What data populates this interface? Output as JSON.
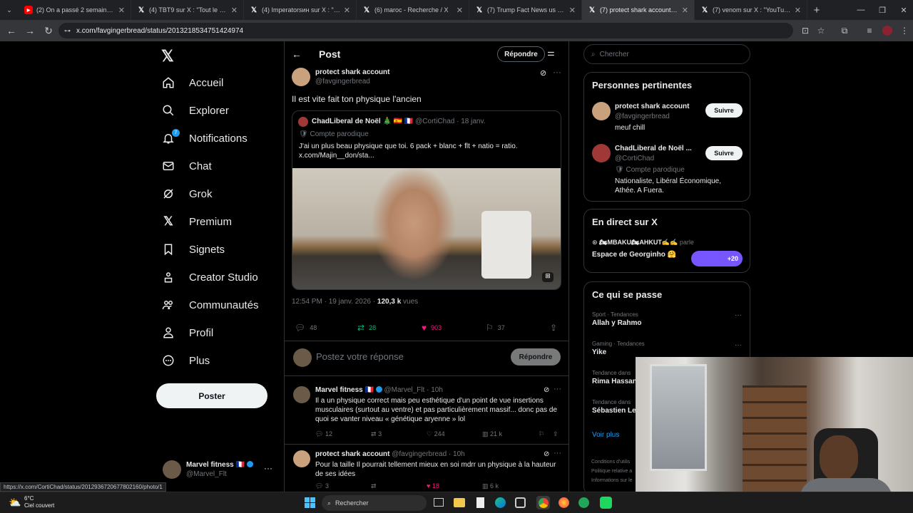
{
  "browser": {
    "tabs": [
      {
        "icon": "youtube-icon",
        "title": "(2) On a passé 2 semaines avec"
      },
      {
        "icon": "x-logo-icon",
        "title": "(4) TBT9 sur X : \"Tout le monde"
      },
      {
        "icon": "x-logo-icon",
        "title": "(4) Imperatorsин sur X : \"Même"
      },
      {
        "icon": "x-logo-icon",
        "title": "(6) maroc - Recherche / X"
      },
      {
        "icon": "x-logo-icon",
        "title": "(7) Trump Fact News us sur X :"
      },
      {
        "icon": "x-logo-icon",
        "title": "(7) protect shark account sur X"
      },
      {
        "icon": "x-logo-icon",
        "title": "(7) venom sur X : \"YouTuber Je"
      }
    ],
    "active_tab": 5,
    "url": "x.com/favgingerbread/status/2013218534751424974",
    "status_url": "https://x.com/CortiChad/status/2012936720677802160/photo/1"
  },
  "leftnav": {
    "items": [
      {
        "icon": "home-icon",
        "label": "Accueil"
      },
      {
        "icon": "search-icon",
        "label": "Explorer"
      },
      {
        "icon": "bell-icon",
        "label": "Notifications",
        "badge": "7"
      },
      {
        "icon": "mail-icon",
        "label": "Chat"
      },
      {
        "icon": "grok-icon",
        "label": "Grok"
      },
      {
        "icon": "x-logo-icon",
        "label": "Premium"
      },
      {
        "icon": "bookmark-icon",
        "label": "Signets"
      },
      {
        "icon": "creator-icon",
        "label": "Creator Studio"
      },
      {
        "icon": "people-icon",
        "label": "Communautés"
      },
      {
        "icon": "person-icon",
        "label": "Profil"
      },
      {
        "icon": "more-circle-icon",
        "label": "Plus"
      }
    ],
    "post_button": "Poster",
    "account": {
      "name": "Marvel fitness 🇫🇷",
      "handle": "@Marvel_Flt"
    }
  },
  "main": {
    "header": {
      "title": "Post",
      "reply_button": "Répondre"
    },
    "post": {
      "name": "protect shark account",
      "handle": "@favgingerbread",
      "text": "Il est vite fait ton physique l'ancien",
      "quote": {
        "name": "ChadLiberal de Noël 🎄 🇪🇸 🇫🇷",
        "handle": "@CortiChad",
        "date": "· 18 janv.",
        "label": "Compte parodique",
        "text": "J'ai un plus beau physique que toi. 6 pack + blanc + flt + natio = ratio. x.com/Majin__don/sta..."
      },
      "time": "12:54 PM · 19 janv. 2026 ·",
      "views": "120,3 k",
      "views_label": "vues",
      "replies": "48",
      "reposts": "28",
      "likes": "903",
      "bookmarks": "37"
    },
    "reply_box": {
      "placeholder": "Postez votre réponse",
      "button": "Répondre"
    },
    "replies": [
      {
        "name": "Marvel fitness 🇫🇷",
        "handle": "@Marvel_Flt · 10h",
        "text": "Il a un physique correct mais peu esthétique d'un point de vue insertions musculaires (surtout au ventre) et pas particulièrement massif... donc pas de quoi se vanter niveau « génétique aryenne » lol",
        "replies": "12",
        "reposts": "3",
        "likes": "244",
        "views": "21 k"
      },
      {
        "name": "protect shark account",
        "handle": "@favgingerbread · 10h",
        "text": "Pour la taille Il pourrait tellement mieux en soi mdrr un physique à la hauteur de ses idées",
        "replies": "3",
        "reposts": "",
        "likes": "18",
        "views": "6 k"
      }
    ]
  },
  "right": {
    "search_placeholder": "Chercher",
    "relevant": {
      "title": "Personnes pertinentes",
      "people": [
        {
          "name": "protect shark account",
          "handle": "@favgingerbread",
          "bio": "meuf chill",
          "button": "Suivre"
        },
        {
          "name": "ChadLiberal de Noël ...",
          "handle": "@CortiChad",
          "label": "Compte parodique",
          "bio": "Nationaliste, Libéral Économique, Athée. A Fuera.",
          "button": "Suivre"
        }
      ]
    },
    "live": {
      "title": "En direct sur X",
      "host": "🏍MBAKU🏍AHKUT✍✍",
      "speaks": "parle",
      "space": "Espace de Georginho 🤗",
      "count": "+20"
    },
    "trends": {
      "title": "Ce qui se passe",
      "items": [
        {
          "category": "Sport · Tendances",
          "name": "Allah y Rahmo"
        },
        {
          "category": "Gaming · Tendances",
          "name": "Yike"
        },
        {
          "category": "Tendance dans",
          "name": "Rima Hassan"
        },
        {
          "category": "Tendance dans",
          "name": "Sébastien Le"
        }
      ],
      "more": "Voir plus"
    },
    "footer": [
      "Conditions d'utilis",
      "Politique relative a",
      "Informations sur le"
    ]
  },
  "taskbar": {
    "weather_temp": "6°C",
    "weather_desc": "Ciel couvert",
    "search_placeholder": "Rechercher"
  },
  "colors": {
    "accent": "#1d9bf0",
    "repost": "#00ba7c",
    "like": "#f91880",
    "muted": "#71767b"
  }
}
